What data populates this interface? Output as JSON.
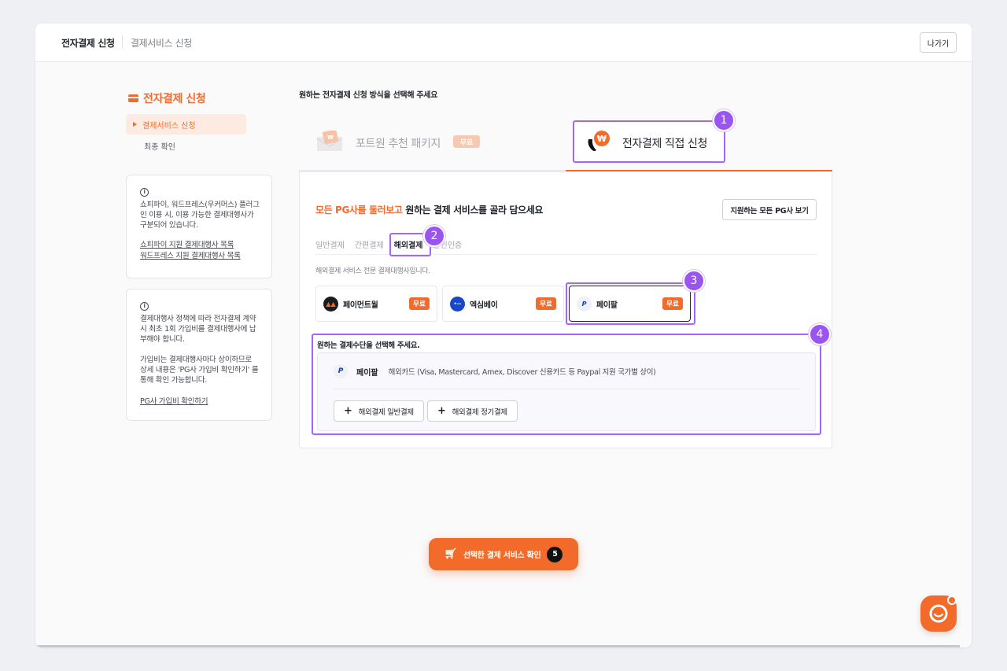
{
  "header": {
    "title": "전자결제 신청",
    "breadcrumb": "결제서비스 신청",
    "exit_label": "나가기"
  },
  "sidebar": {
    "title": "전자결제 신청",
    "items": [
      {
        "label": "결제서비스 신청",
        "active": true
      },
      {
        "label": "최종 확인",
        "active": false
      }
    ],
    "info1": {
      "text": "쇼피파이, 워드프레스(우커머스) 플러그인 이용 시, 이용 가능한 결제대행사가 구분되어 있습니다.",
      "link1": "쇼피파이 지원 결제대행사 목록",
      "link2": "워드프레스 지원 결제대행사 목록"
    },
    "info2": {
      "text1": "결제대행사 정책에 따라 전자결제 계약 시 최초 1회 가입비를 결제대행사에 납부해야 합니다.",
      "text2": "가입비는 결제대행사마다 상이하므로 상세 내용은 'PG사 가입비 확인하기' 를 통해 확인 가능합니다.",
      "link": "PG사 가입비 확인하기"
    }
  },
  "main": {
    "prompt": "원하는 전자결제 신청 방식을 선택해 주세요",
    "tabs": [
      {
        "label": "포트원 추천 패키지",
        "badge": "무료",
        "active": false
      },
      {
        "label": "전자결제 직접 신청",
        "active": true
      }
    ],
    "panel": {
      "headline_highlight": "모든 PG사를 둘러보고",
      "headline_rest": " 원하는 결제 서비스를 골라 담으세요",
      "all_pg_button": "지원하는 모든 PG사 보기",
      "subtabs": [
        "일반결제",
        "간편결제",
        "해외결제",
        "본인인증"
      ],
      "active_subtab": "해외결제",
      "description": "해외결제 서비스 전문 결제대행사입니다.",
      "pg_cards": [
        {
          "name": "페이먼트월",
          "badge": "무료",
          "selected": false
        },
        {
          "name": "엑심베이",
          "badge": "무료",
          "selected": false
        },
        {
          "name": "페이팔",
          "badge": "무료",
          "selected": true
        }
      ],
      "method_prompt": "원하는 결제수단을 선택해 주세요.",
      "method": {
        "name": "페이팔",
        "description": "해외카드 (Visa, Mastercard, Amex, Discover 신용카드 등 Paypal 지원 국가별 상이)",
        "buttons": [
          "해외결제 일반결제",
          "해외결제 정기결제"
        ]
      }
    }
  },
  "annotations": [
    "1",
    "2",
    "3",
    "4"
  ],
  "cta": {
    "label": "선택한 결제 서비스 확인",
    "count": "5"
  },
  "colors": {
    "accent": "#f26b2b",
    "highlight_outline": "#a466f4",
    "badge": "#9a55f0"
  }
}
